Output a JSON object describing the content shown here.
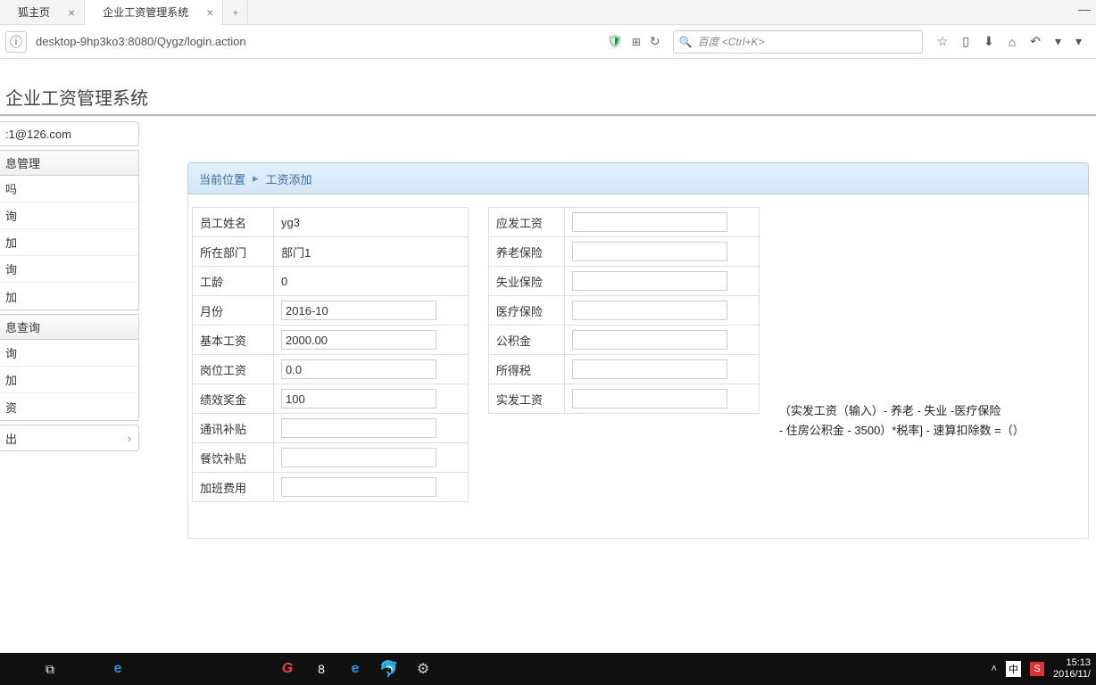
{
  "browser": {
    "tabs": [
      {
        "title": "狐主页",
        "active": false
      },
      {
        "title": "企业工资管理系统",
        "active": true
      }
    ],
    "url": "desktop-9hp3ko3:8080/Qygz/login.action",
    "search_placeholder": "百度 <Ctrl+K>"
  },
  "app": {
    "title": "企业工资管理系统"
  },
  "sidebar": {
    "user": "1@126.com",
    "group1": {
      "head": "息管理",
      "items": [
        "吗",
        "询",
        "加",
        "询",
        "加"
      ]
    },
    "group2": {
      "head": "息查询",
      "items": [
        "询",
        "加",
        "资"
      ]
    },
    "exit": "出"
  },
  "breadcrumb": {
    "location_label": "当前位置",
    "current": "工资添加"
  },
  "form_left": {
    "labels": {
      "name": "员工姓名",
      "dept": "所在部门",
      "seniority": "工龄",
      "month": "月份",
      "base_salary": "基本工资",
      "post_salary": "岗位工资",
      "bonus": "绩效奖金",
      "comm_allow": "通讯补贴",
      "meal_allow": "餐饮补贴",
      "overtime": "加班费用"
    },
    "values": {
      "name": "yg3",
      "dept": "部门1",
      "seniority": "0",
      "month": "2016-10",
      "base_salary": "2000.00",
      "post_salary": "0.0",
      "bonus": "100",
      "comm_allow": "",
      "meal_allow": "",
      "overtime": ""
    }
  },
  "form_right": {
    "labels": {
      "due_pay": "应发工资",
      "pension": "养老保险",
      "unemployment": "失业保险",
      "medical": "医疗保险",
      "fund": "公积金",
      "tax": "所得税",
      "net_pay": "实发工资"
    },
    "values": {
      "due_pay": "",
      "pension": "",
      "unemployment": "",
      "medical": "",
      "fund": "",
      "tax": "",
      "net_pay": ""
    }
  },
  "formula_line1": "（实发工资（输入）- 养老 - 失业 -医疗保险",
  "formula_line2": "- 住房公积金 - 3500）*税率] - 速算扣除数 =（）",
  "taskbar": {
    "time": "15:13",
    "date": "2016/11/",
    "ime": "中",
    "red": "S"
  }
}
